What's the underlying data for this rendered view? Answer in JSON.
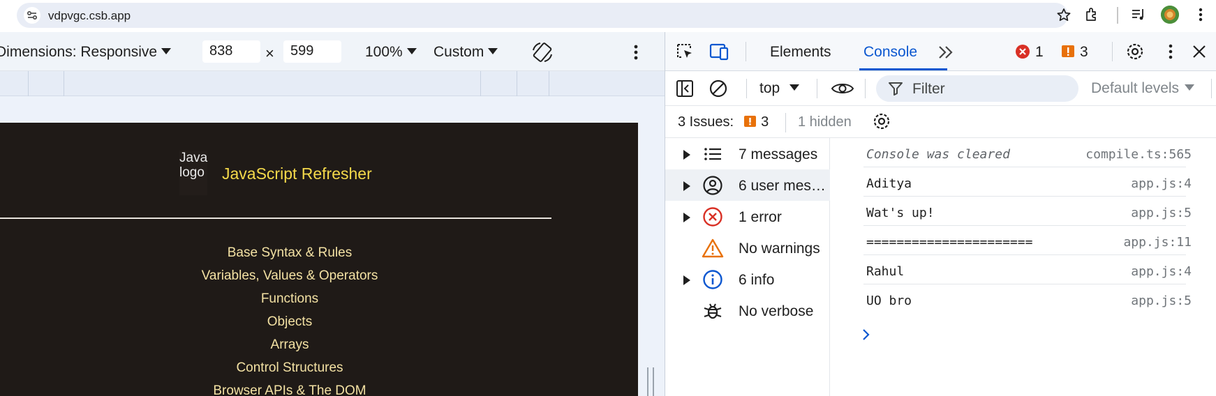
{
  "browser": {
    "url": "vdpvgc.csb.app",
    "icons": [
      "tune-icon",
      "star-icon",
      "extensions-icon",
      "media-control-icon",
      "avatar",
      "more-vert-icon"
    ]
  },
  "device_toolbar": {
    "dimensions_label": "Dimensions: Responsive",
    "width": "838",
    "times": "×",
    "height": "599",
    "zoom": "100%",
    "throttle": "Custom"
  },
  "page": {
    "logo_alt": "Java logo",
    "logo_alt_lines": [
      "Java",
      "logo"
    ],
    "title": "JavaScript Refresher",
    "nav_items": [
      "Base Syntax & Rules",
      "Variables, Values & Operators",
      "Functions",
      "Objects",
      "Arrays",
      "Control Structures",
      "Browser APIs & The DOM"
    ],
    "colors": {
      "background": "#1f1a17",
      "title": "#f4d94a",
      "link": "#f3e1a3"
    }
  },
  "devtools": {
    "tabs": [
      {
        "label": "Elements",
        "active": false
      },
      {
        "label": "Console",
        "active": true
      }
    ],
    "error_count": "1",
    "warning_count": "3",
    "context": "top",
    "filter_placeholder": "Filter",
    "levels": "Default levels",
    "issues_label": "3 Issues:",
    "issues_count": "3",
    "hidden_label": "1 hidden",
    "sidebar": [
      {
        "label": "7 messages",
        "icon": "list-icon",
        "expandable": true,
        "selected": false
      },
      {
        "label": "6 user mes…",
        "icon": "user-circle-icon",
        "expandable": true,
        "selected": true
      },
      {
        "label": "1 error",
        "icon": "error-icon",
        "expandable": true,
        "selected": false
      },
      {
        "label": "No warnings",
        "icon": "warning-icon",
        "expandable": false,
        "selected": false
      },
      {
        "label": "6 info",
        "icon": "info-icon",
        "expandable": true,
        "selected": false
      },
      {
        "label": "No verbose",
        "icon": "bug-icon",
        "expandable": false,
        "selected": false
      }
    ],
    "messages": [
      {
        "text": "Console was cleared",
        "source": "compile.ts:565",
        "italic": true
      },
      {
        "text": "Aditya",
        "source": "app.js:4",
        "italic": false
      },
      {
        "text": "Wat's up!",
        "source": "app.js:5",
        "italic": false
      },
      {
        "text": "======================",
        "source": "app.js:11",
        "italic": false
      },
      {
        "text": "Rahul",
        "source": "app.js:4",
        "italic": false
      },
      {
        "text": "UO bro",
        "source": "app.js:5",
        "italic": false
      }
    ],
    "colors": {
      "accent": "#0b57d0",
      "error": "#d93025",
      "warning": "#e8710a"
    }
  }
}
